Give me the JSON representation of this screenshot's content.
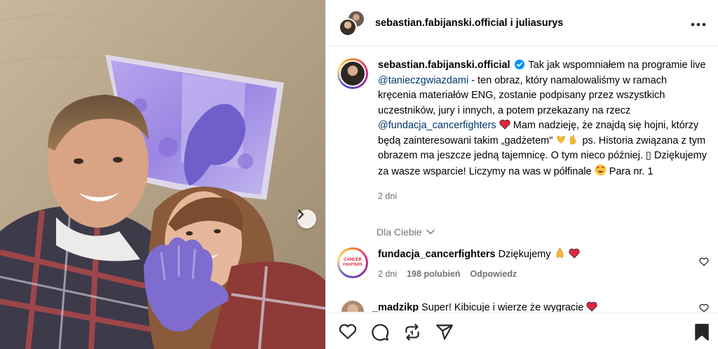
{
  "header": {
    "user1": "sebastian.fabijanski.official",
    "joiner": "i",
    "user2": "juliasurys",
    "more_icon": "more-horizontal-icon"
  },
  "caption": {
    "username": "sebastian.fabijanski.official",
    "text_1": "Tak jak wspomniałem na programie live",
    "mention_1": "@tanieczgwiazdami",
    "text_2": "- ten obraz, który namalowaliśmy w ramach kręcenia materiałów ENG, zostanie podpisany przez wszystkich uczestników, jury i innych, a potem przekazany na rzecz",
    "mention_2": "@fundacja_cancerfighters",
    "text_3": "Mam nadzieję, że znajdą się hojni, którzy będą zainteresowani takim „gadżetem\"",
    "text_4": "ps. Historia związana z tym obrazem ma jeszcze jedną tajemnicę. O tym nieco później. ",
    "placeholder_glyph": "▯",
    "text_5": " Dziękujemy za wasze wsparcie! Liczymy na was w półfinale",
    "text_6": "Para nr. 1",
    "time": "2 dni"
  },
  "for_you": {
    "label": "Dla Ciebie"
  },
  "comments": [
    {
      "username": "fundacja_cancerfighters",
      "avatar_line1": "CANCER",
      "avatar_line2": "FIGHTERS",
      "text": "Dziękujemy",
      "time": "2 dni",
      "likes": "198 polubień",
      "reply": "Odpowiedz"
    },
    {
      "username": "_madzikp",
      "text": "Super! Kibicuje i wierze że wygracie"
    }
  ],
  "colors": {
    "mention": "#00376b",
    "secondary_text": "#737373",
    "heart_red": "#ed2945",
    "verified_blue": "#0095f6"
  },
  "icons": [
    "heart-icon",
    "comment-icon",
    "repost-icon",
    "share-icon",
    "bookmark-icon",
    "chevron-right-icon",
    "chevron-down-icon"
  ]
}
